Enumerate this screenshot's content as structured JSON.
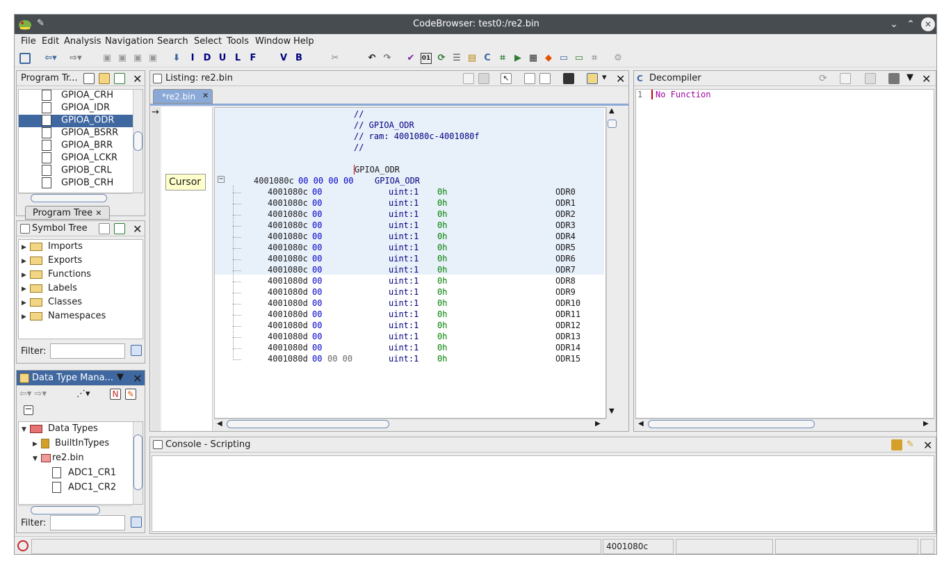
{
  "window": {
    "title": "CodeBrowser: test0:/re2.bin"
  },
  "menu": [
    "File",
    "Edit",
    "Analysis",
    "Navigation",
    "Search",
    "Select",
    "Tools",
    "Window",
    "Help"
  ],
  "toolbar_letters": [
    "I",
    "D",
    "U",
    "L",
    "F",
    "V",
    "B"
  ],
  "program_tree": {
    "title": "Program Tr...",
    "items": [
      "GPIOA_CRH",
      "GPIOA_IDR",
      "GPIOA_ODR",
      "GPIOA_BSRR",
      "GPIOA_BRR",
      "GPIOA_LCKR",
      "GPIOB_CRL",
      "GPIOB_CRH"
    ],
    "selected_index": 2,
    "tab_label": "Program Tree"
  },
  "symbol_tree": {
    "title": "Symbol Tree",
    "items": [
      "Imports",
      "Exports",
      "Functions",
      "Labels",
      "Classes",
      "Namespaces"
    ],
    "filter_label": "Filter:"
  },
  "data_type_manager": {
    "title": "Data Type Mana...",
    "root": "Data Types",
    "children": [
      "BuiltInTypes",
      "re2.bin"
    ],
    "types": [
      "ADC1_CR1",
      "ADC1_CR2"
    ],
    "filter_label": "Filter:"
  },
  "listing": {
    "title": "Listing:  re2.bin",
    "tab": "*re2.bin",
    "cursor_tooltip": "Cursor",
    "comments": [
      "//",
      "// GPIOA_ODR",
      "// ram: 4001080c-4001080f",
      "//"
    ],
    "label": "GPIOA_ODR",
    "struct_addr": "4001080c",
    "struct_bytes": "00 00 00 00",
    "struct_name": "GPIOA_ODR",
    "fields": [
      {
        "addr": "4001080c",
        "b1": "00",
        "b2": "",
        "type": "uint:1",
        "val": "0h",
        "name": "ODR0"
      },
      {
        "addr": "4001080c",
        "b1": "00",
        "b2": "",
        "type": "uint:1",
        "val": "0h",
        "name": "ODR1"
      },
      {
        "addr": "4001080c",
        "b1": "00",
        "b2": "",
        "type": "uint:1",
        "val": "0h",
        "name": "ODR2"
      },
      {
        "addr": "4001080c",
        "b1": "00",
        "b2": "",
        "type": "uint:1",
        "val": "0h",
        "name": "ODR3"
      },
      {
        "addr": "4001080c",
        "b1": "00",
        "b2": "",
        "type": "uint:1",
        "val": "0h",
        "name": "ODR4"
      },
      {
        "addr": "4001080c",
        "b1": "00",
        "b2": "",
        "type": "uint:1",
        "val": "0h",
        "name": "ODR5"
      },
      {
        "addr": "4001080c",
        "b1": "00",
        "b2": "",
        "type": "uint:1",
        "val": "0h",
        "name": "ODR6"
      },
      {
        "addr": "4001080c",
        "b1": "00",
        "b2": "",
        "type": "uint:1",
        "val": "0h",
        "name": "ODR7"
      },
      {
        "addr": "4001080d",
        "b1": "00",
        "b2": "",
        "type": "uint:1",
        "val": "0h",
        "name": "ODR8"
      },
      {
        "addr": "4001080d",
        "b1": "00",
        "b2": "",
        "type": "uint:1",
        "val": "0h",
        "name": "ODR9"
      },
      {
        "addr": "4001080d",
        "b1": "00",
        "b2": "",
        "type": "uint:1",
        "val": "0h",
        "name": "ODR10"
      },
      {
        "addr": "4001080d",
        "b1": "00",
        "b2": "",
        "type": "uint:1",
        "val": "0h",
        "name": "ODR11"
      },
      {
        "addr": "4001080d",
        "b1": "00",
        "b2": "",
        "type": "uint:1",
        "val": "0h",
        "name": "ODR12"
      },
      {
        "addr": "4001080d",
        "b1": "00",
        "b2": "",
        "type": "uint:1",
        "val": "0h",
        "name": "ODR13"
      },
      {
        "addr": "4001080d",
        "b1": "00",
        "b2": "",
        "type": "uint:1",
        "val": "0h",
        "name": "ODR14"
      },
      {
        "addr": "4001080d",
        "b1": "00",
        "b2": "00 00",
        "type": "uint:1",
        "val": "0h",
        "name": "ODR15"
      }
    ]
  },
  "decompiler": {
    "title": "Decompiler",
    "line_no": "1",
    "text": "No Function"
  },
  "console": {
    "title": "Console - Scripting"
  },
  "status": {
    "address": "4001080c"
  }
}
